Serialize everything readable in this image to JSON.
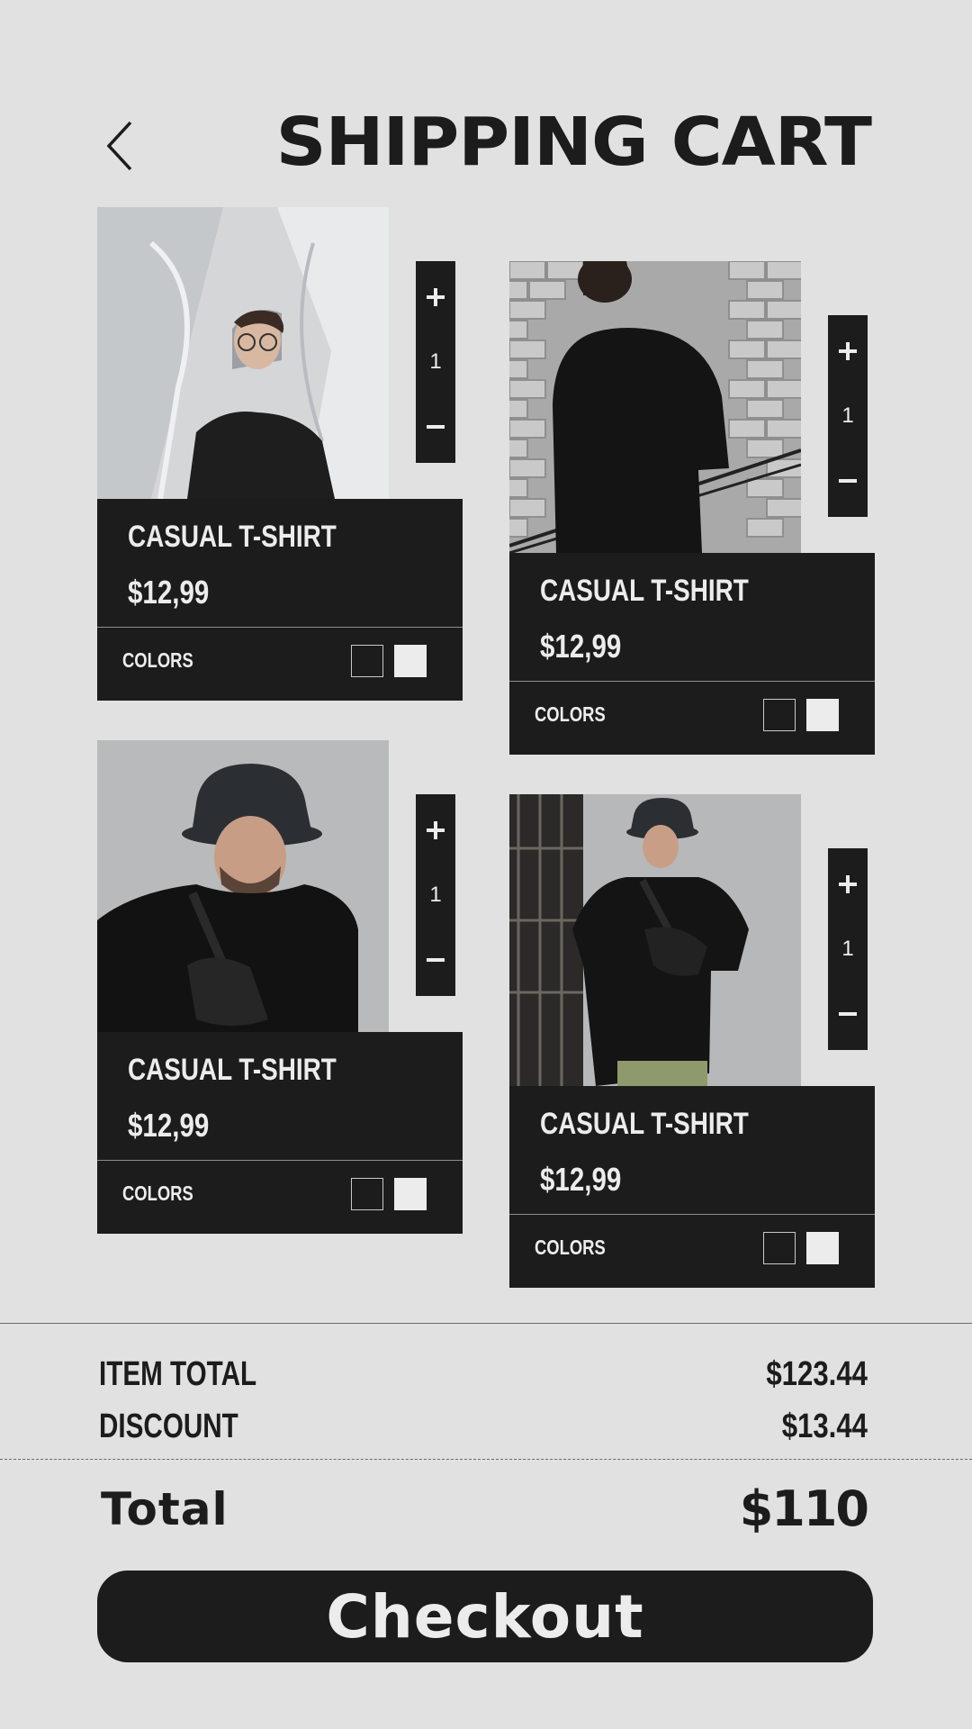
{
  "header": {
    "title": "SHIPPING CART"
  },
  "products": [
    {
      "name": "CASUAL T-SHIRT",
      "price": "$12,99",
      "colors_label": "COLORS",
      "quantity": "1"
    },
    {
      "name": "CASUAL T-SHIRT",
      "price": "$12,99",
      "colors_label": "COLORS",
      "quantity": "1"
    },
    {
      "name": "CASUAL T-SHIRT",
      "price": "$12,99",
      "colors_label": "COLORS",
      "quantity": "1"
    },
    {
      "name": "CASUAL T-SHIRT",
      "price": "$12,99",
      "colors_label": "COLORS",
      "quantity": "1"
    }
  ],
  "summary": {
    "item_total_label": "ITEM TOTAL",
    "item_total_value": "$123.44",
    "discount_label": "DISCOUNT",
    "discount_value": "$13.44",
    "total_label": "Total",
    "total_value": "$110"
  },
  "checkout": {
    "label": "Checkout"
  },
  "icons": {
    "back": "chevron-left-icon",
    "plus": "plus-icon",
    "minus": "minus-icon"
  },
  "colors": {
    "background": "#e1e1e1",
    "dark": "#1c1c1c",
    "light": "#ececec"
  }
}
